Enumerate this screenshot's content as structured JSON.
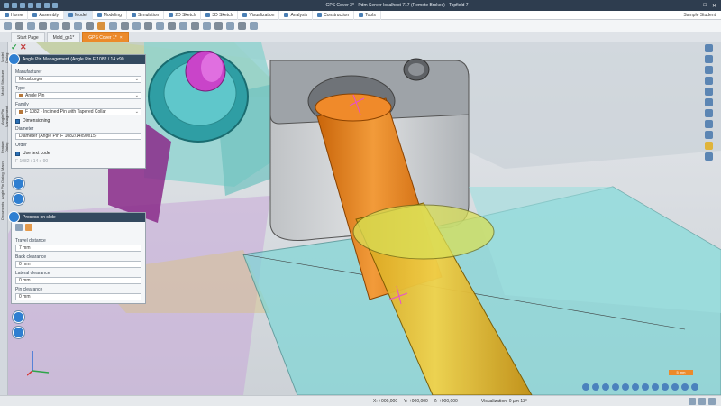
{
  "window": {
    "title": "GPS Cover 3* - Pdm Server localhost 717 (Remote Brokes) - Topfield 7",
    "controls": [
      "–",
      "□",
      "✕"
    ]
  },
  "menu": {
    "tabs": [
      "Home",
      "Assembly",
      "Model",
      "Modeling",
      "Simulation",
      "2D Sketch",
      "3D Sketch",
      "Visualization",
      "Analysis",
      "Construction",
      "Tools"
    ],
    "active": "Model",
    "user": "Sample Student"
  },
  "doc_tabs": [
    {
      "label": "Start Page",
      "active": false
    },
    {
      "label": "Mold_gs1*",
      "active": false
    },
    {
      "label": "GPS Cover 1*",
      "active": true
    }
  ],
  "side_tabs": [
    "Model Dialog",
    "Model Structure",
    "Angle Pin Management",
    "Feature Dialog",
    "Macro",
    "Angle Pin Dialog",
    "Documents"
  ],
  "panel": {
    "title": "Angle Pin Management (Angle Pin F 1082 / 14 x90 ...",
    "manufacturer_label": "Manufacturer",
    "manufacturer_value": "Meusburger",
    "type_label": "Type",
    "type_value": "Angle Pin",
    "family_label": "Family",
    "family_value": "F 1082 - Inclined Pin with Tapered Collar",
    "dim_checkbox": "Dimensioning",
    "diameter_label": "Diameter",
    "diameter_value": "Diameter (Angle Pin F 1082/14x90x15)",
    "order_label": "Order",
    "use_text_code": "Use text code",
    "order_value": "F 1082 / 14 x 90"
  },
  "panel2": {
    "title": "Process on slide",
    "travel_label": "Travel distance",
    "travel_value": "7 mm",
    "back_label": "Back clearance",
    "back_value": "0 mm",
    "lateral_label": "Lateral clearance",
    "lateral_value": "0 mm",
    "pin_label": "Pin clearance",
    "pin_value": "0 mm"
  },
  "scalebar": "5 mm",
  "status": {
    "x": "X: +000,000",
    "y": "Y: +000,000",
    "z": "Z: +000,000",
    "visualization": "Visualization: 0 µm 13°"
  },
  "colors": {
    "accent": "#ec8a2a",
    "titlebar": "#2e3d4f",
    "pin_orange": "#e07a10",
    "pin_yellow": "#e8c62a",
    "slide_teal": "#7ed6d6",
    "cavity_magenta": "#d24fd2"
  }
}
